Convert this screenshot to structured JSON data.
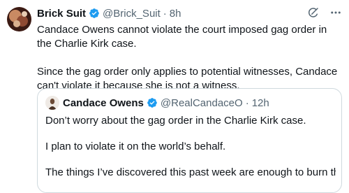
{
  "tweet": {
    "author_name": "Brick Suit",
    "handle": "@Brick_Suit",
    "separator": "·",
    "time": "8h",
    "paragraphs": [
      "Candace Owens cannot violate the court imposed gag order in the Charlie Kirk case.",
      "Since the gag order only applies to potential witnesses, Candace can't violate it because she is not a witness."
    ],
    "icons": {
      "verified": "verified-badge-icon",
      "grok": "grok-icon",
      "more": "more-options-icon"
    }
  },
  "quoted_tweet": {
    "author_name": "Candace Owens",
    "handle": "@RealCandaceO",
    "separator": "·",
    "time": "12h",
    "paragraphs": [
      "Don’t worry about the gag order in the Charlie Kirk case.",
      "I plan to violate it on the world’s behalf.",
      "The things I’ve discovered this past week are enough to burn the hous…"
    ]
  },
  "colors": {
    "verified_blue": "#1d9bf0",
    "text_primary": "#0f1419",
    "text_secondary": "#536471",
    "border": "#cfd9de"
  }
}
